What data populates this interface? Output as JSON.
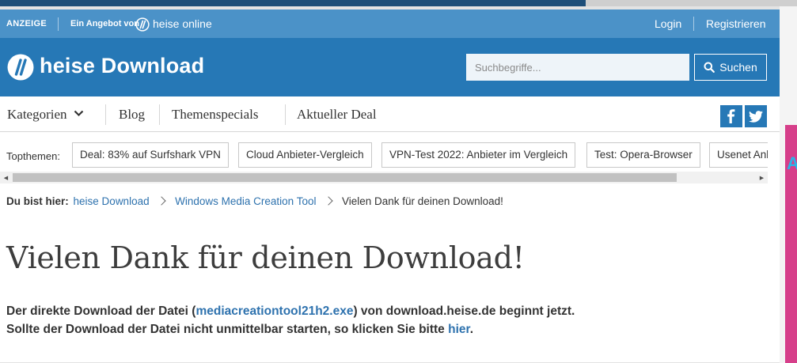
{
  "ad_bar": {
    "anzeige_label": "ANZEIGE",
    "offer_label": "Ein Angebot von",
    "brand_name": "heise online",
    "login_label": "Login",
    "register_label": "Registrieren"
  },
  "header": {
    "logo_text": "heise Download",
    "search": {
      "placeholder": "Suchbegriffe...",
      "value": ""
    },
    "search_button_label": "Suchen",
    "search_icon": "search-icon"
  },
  "nav": {
    "kategorien_label": "Kategorien",
    "kategorien_icon": "chevron-down-icon",
    "blog_label": "Blog",
    "themenspecials_label": "Themenspecials",
    "deal_label": "Aktueller Deal",
    "social_icons": [
      "facebook-icon",
      "twitter-icon"
    ]
  },
  "topthemen": {
    "label": "Topthemen:",
    "chips": [
      "Deal: 83% auf Surfshark VPN",
      "Cloud Anbieter-Vergleich",
      "VPN-Test 2022: Anbieter im Vergleich",
      "Test: Opera-Browser",
      "Usenet Anbieter"
    ]
  },
  "breadcrumb": {
    "prefix": "Du bist hier:",
    "items": [
      "heise Download",
      "Windows Media Creation Tool",
      "Vielen Dank für deinen Download!"
    ]
  },
  "main": {
    "title": "Vielen Dank für deinen Download!",
    "line1_before": "Der direkte Download der Datei (",
    "line1_link": "mediacreationtool21h2.exe",
    "line1_after": ") von download.heise.de beginnt jetzt.",
    "line2_before": "Sollte der Download der Datei nicht unmittelbar starten, so klicken Sie bitte ",
    "line2_link": "hier",
    "line2_after": "."
  },
  "colors": {
    "ad_bar": "#4b92c8",
    "header": "#2678b6",
    "link": "#2e72ae"
  }
}
